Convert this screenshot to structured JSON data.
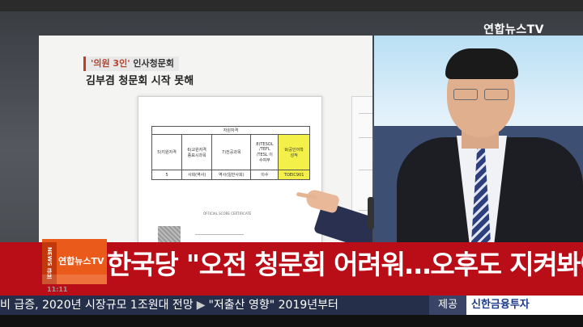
{
  "broadcaster": {
    "logo_text": "연합뉴스TV"
  },
  "segment": {
    "tag_highlight": "'의원 3인'",
    "tag_rest": " 인사청문회",
    "subtitle": "김부겸 청문회 시작 못해"
  },
  "document": {
    "table_title": "자원자격",
    "columns": [
      "5)지원자격",
      "6)교원자격\n종묘시과목",
      "7)전공과목",
      "8)TESOL\n/TEFL\n/TESL 이\n수여부",
      "9)공인어학\n성적"
    ],
    "values": [
      "5",
      "사회(역사)",
      "역사(일반사회)",
      "이수",
      "TOEIC901"
    ],
    "form_caption": "OFFICIAL SCORE CERTIFICATE"
  },
  "lower_third": {
    "logo_vertical": "NEWS 큐브",
    "logo_text": "연합뉴스TV",
    "headline": "한국당 \"오전 청문회 어려워…오후도 지켜봐야\"",
    "clock": "11:11"
  },
  "ticker": {
    "item_1": "비 급증, 2020년 시장규모  1조원대 전망",
    "item_2": "\"저출산 영향\" 2019년부터",
    "sponsor_tag": "제공",
    "sponsor_name": "신한금융투자"
  },
  "colors": {
    "headline_bg": "#b90d17",
    "ticker_bg": "#262f4a",
    "logo_orange": "#ea5a1a"
  }
}
